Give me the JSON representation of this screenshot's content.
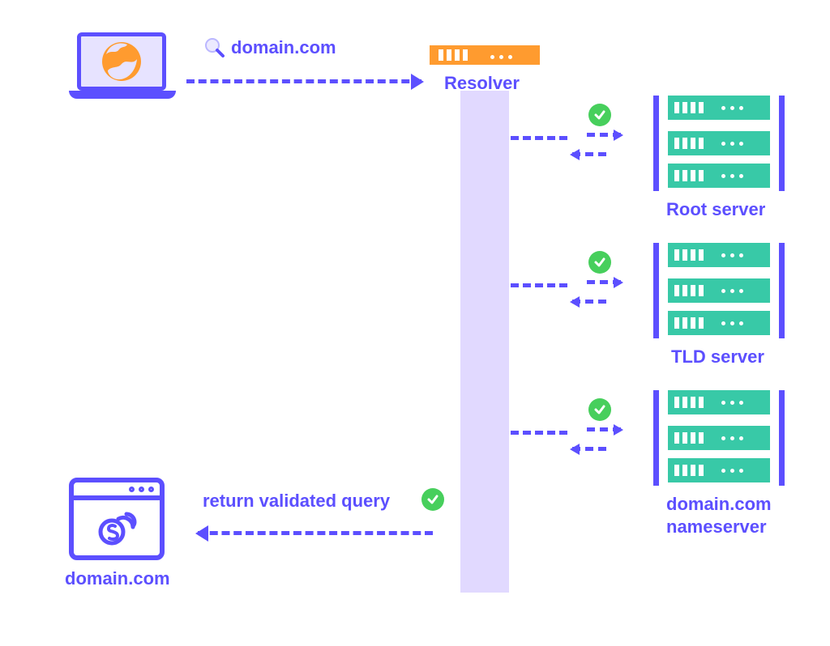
{
  "query_label": "domain.com",
  "resolver_label": "Resolver",
  "return_label": "return validated query",
  "browser_label": "domain.com",
  "servers": {
    "root": "Root server",
    "tld": "TLD server",
    "ns_line1": "domain.com",
    "ns_line2": "nameserver"
  },
  "colors": {
    "primary": "#5c4fff",
    "accent_orange": "#ff9b2f",
    "accent_teal": "#38c9a7",
    "ok_green": "#47cf5c",
    "lilac": "#e1d9ff"
  }
}
